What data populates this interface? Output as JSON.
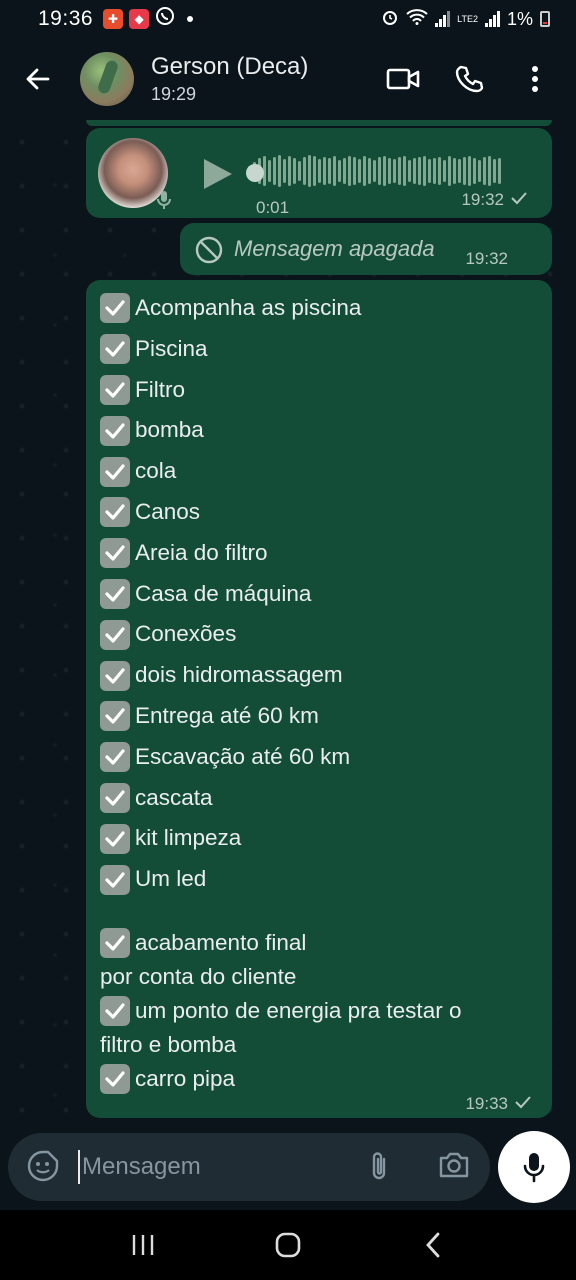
{
  "status_bar": {
    "time": "19:36",
    "battery": "1%",
    "network": "LTE2"
  },
  "header": {
    "contact_name": "Gerson (Deca)",
    "contact_status": "19:29",
    "icons": [
      "back-arrow-icon",
      "video-call-icon",
      "phone-icon",
      "more-vertical-icon"
    ]
  },
  "messages": [
    {
      "type": "voice",
      "duration": "0:01",
      "time": "19:32",
      "status": "sent"
    },
    {
      "type": "deleted",
      "text": "Mensagem apagada",
      "time": "19:32"
    },
    {
      "type": "checklist",
      "items": [
        "Acompanha as piscina",
        "Piscina",
        "Filtro",
        "bomba",
        "cola",
        "Canos",
        "Areia do filtro",
        "Casa de máquina",
        "Conexões",
        "dois hidromassagem",
        "Entrega até 60 km",
        "Escavação até 60 km",
        "cascata",
        "kit limpeza",
        "Um led"
      ],
      "extra": [
        {
          "first": "acabamento final",
          "rest": "por conta do cliente"
        },
        {
          "first": "um ponto de energia pra testar o",
          "rest": "filtro e bomba"
        },
        {
          "first": " carro pipa",
          "rest": ""
        }
      ],
      "time": "19:33",
      "status": "sent"
    }
  ],
  "composer": {
    "placeholder": "Mensagem"
  },
  "colors": {
    "background": "#0b141a",
    "outgoing_bubble": "#144d37",
    "composer": "#1f2c34"
  }
}
